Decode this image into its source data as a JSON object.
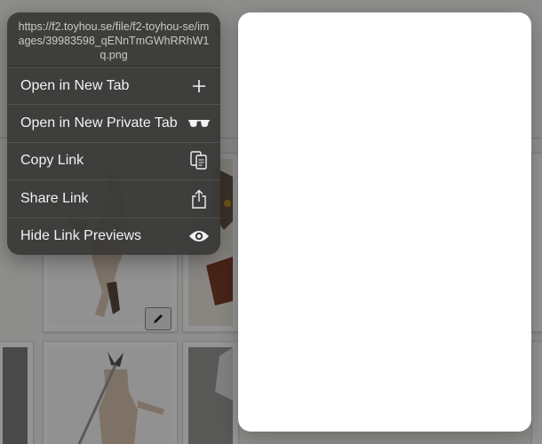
{
  "background_page": {
    "title_fragment": "t"
  },
  "context_menu": {
    "link_url": "https://f2.toyhou.se/file/f2-toyhou-se/images/39983598_qENnTmGWhRRhW1q.png",
    "items": [
      {
        "label": "Open in New Tab",
        "icon": "plus-icon"
      },
      {
        "label": "Open in New Private Tab",
        "icon": "private-glasses-icon"
      },
      {
        "label": "Copy Link",
        "icon": "copy-icon"
      },
      {
        "label": "Share Link",
        "icon": "share-icon"
      },
      {
        "label": "Hide Link Previews",
        "icon": "eye-icon"
      }
    ]
  },
  "colors": {
    "menu_background": "#3a3a38",
    "menu_text": "#f2f2f2",
    "url_text": "#c9c9c7",
    "preview_background": "#ffffff"
  }
}
